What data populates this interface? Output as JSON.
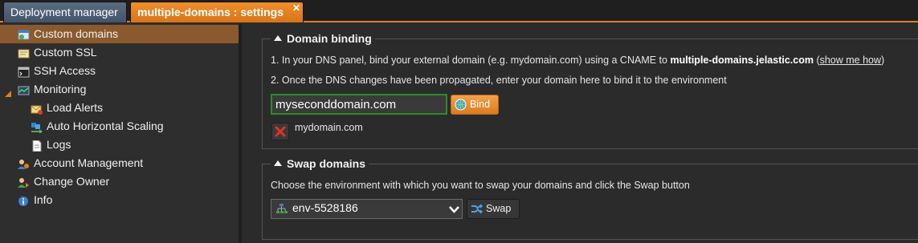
{
  "tabs": [
    {
      "label": "Deployment manager",
      "active": false
    },
    {
      "label": "multiple-domains : settings",
      "active": true,
      "close": "✕"
    }
  ],
  "sidebar": {
    "items": [
      {
        "label": "Custom domains",
        "icon": "custom-domains-icon",
        "active": true
      },
      {
        "label": "Custom SSL",
        "icon": "ssl-certificate-icon"
      },
      {
        "label": "SSH Access",
        "icon": "terminal-icon"
      },
      {
        "label": "Monitoring",
        "icon": "monitoring-icon",
        "expanded": true
      },
      {
        "label": "Load Alerts",
        "icon": "envelope-alert-icon"
      },
      {
        "label": "Auto Horizontal Scaling",
        "icon": "scaling-icon"
      },
      {
        "label": "Logs",
        "icon": "document-icon"
      },
      {
        "label": "Account Management",
        "icon": "account-icon"
      },
      {
        "label": "Change Owner",
        "icon": "change-owner-icon"
      },
      {
        "label": "Info",
        "icon": "info-icon"
      }
    ]
  },
  "binding": {
    "legend": "Domain binding",
    "step1_prefix": "1. In your DNS panel, bind your external domain (e.g. mydomain.com) using a CNAME to ",
    "step1_host": "multiple-domains.jelastic.com",
    "step1_open": " (",
    "step1_link": "show me how",
    "step1_close": ")",
    "step2": "2. Once the DNS changes have been propagated, enter your domain here to bind it to the environment",
    "domain_value": "myseconddomain.com",
    "bind_label": "Bind",
    "bound_domain": "mydomain.com"
  },
  "swap": {
    "legend": "Swap domains",
    "instructions": "Choose the environment with which you want to swap your domains and click the Swap button",
    "env_selected": "env-5528186",
    "swap_label": "Swap"
  },
  "colors": {
    "accent": "#e07f1f",
    "active_sidebar": "#8a5a2e",
    "input_border": "#2e8a2e"
  }
}
